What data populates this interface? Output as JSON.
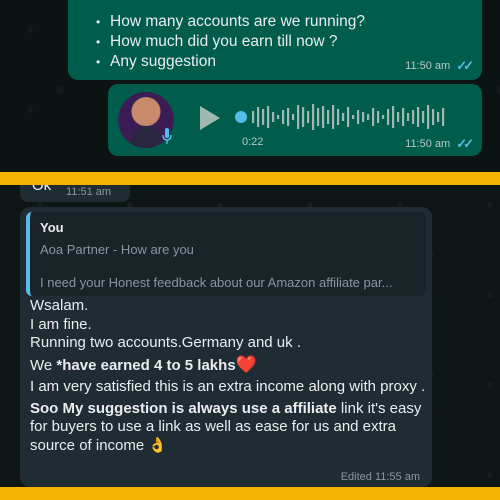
{
  "messages": {
    "outgoing_list": {
      "items": [
        "How many accounts are we running?",
        "How much did you earn till now ?",
        "Any suggestion"
      ],
      "time": "11:50 am"
    },
    "voice_note": {
      "duration": "0:22",
      "time": "11:50 am"
    },
    "partial_incoming": {
      "text": "Ok",
      "time": "11:51 am"
    },
    "reply": {
      "quote_author": "You",
      "quote_line1": "Aoa Partner  - How are you",
      "quote_line2": "I need your Honest feedback about our Amazon affiliate par...",
      "line_greeting": "Wsalam.",
      "line_fine": "I am fine.",
      "line_accounts": "Running two accounts.Germany and uk .",
      "earned_prefix": "We ",
      "earned_bold": "*have earned 4 to 5 lakhs",
      "heart": "❤️",
      "line_satisfied": "I am very satisfied this is an extra income along with proxy .",
      "suggestion_bold": " Soo  My suggestion is always use a affiliate",
      "suggestion_rest": " link it's easy for buyers to use a link as well as ease for us and extra source of income",
      "hand_emoji": "👌",
      "edited_time": "Edited  11:55 am"
    }
  },
  "colors": {
    "outgoing_bubble": "#005c4b",
    "incoming_bubble": "#202c33",
    "read_ticks": "#53bdeb",
    "divider_bar": "#f2b400"
  },
  "icons": {
    "ticks": "double-check-icon",
    "play": "play-icon",
    "mic": "mic-icon",
    "avatar": "avatar"
  }
}
